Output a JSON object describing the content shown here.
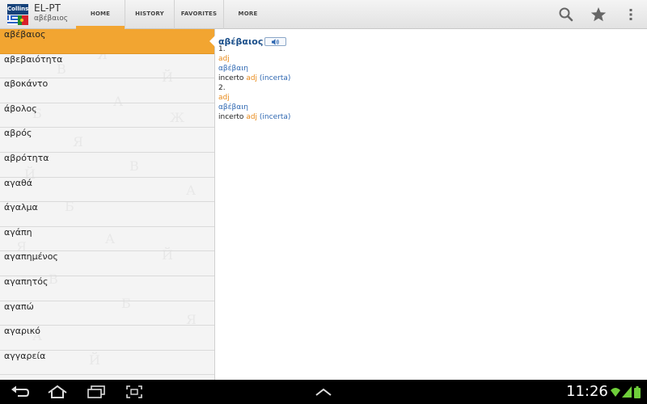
{
  "app": {
    "logo_text": "Collins",
    "title": "EL-PT",
    "subtitle": "αβέβαιος"
  },
  "tabs": [
    {
      "label": "HOME",
      "active": true
    },
    {
      "label": "HISTORY",
      "active": false
    },
    {
      "label": "FAVORITES",
      "active": false
    },
    {
      "label": "MORE",
      "active": false
    }
  ],
  "actions": [
    {
      "icon": "search-icon"
    },
    {
      "icon": "star-icon"
    },
    {
      "icon": "overflow-menu-icon"
    }
  ],
  "wordlist": {
    "selected_index": 0,
    "items": [
      "αβέβαιος",
      "αβεβαιότητα",
      "αβοκάντο",
      "άβολος",
      "αβρός",
      "αβρότητα",
      "αγαθά",
      "άγαλμα",
      "αγάπη",
      "αγαπημένος",
      "αγαπητός",
      "αγαπώ",
      "αγαρικό",
      "αγγαρεία"
    ]
  },
  "entry": {
    "headword": "αβέβαιος",
    "senses": [
      {
        "number": "1.",
        "pos": "adj",
        "greek": "αβέβαιη",
        "pt_word": "incerto",
        "pt_pos": "adj",
        "pt_paren": "(incerta)"
      },
      {
        "number": "2.",
        "pos": "adj",
        "greek": "αβέβαιη",
        "pt_word": "incerto",
        "pt_pos": "adj",
        "pt_paren": "(incerta)"
      }
    ]
  },
  "statusbar": {
    "time": "11:26"
  },
  "colors": {
    "accent": "#f2a531",
    "headword": "#1b4f8a",
    "pos": "#e88a1a",
    "link": "#2e67b1"
  }
}
